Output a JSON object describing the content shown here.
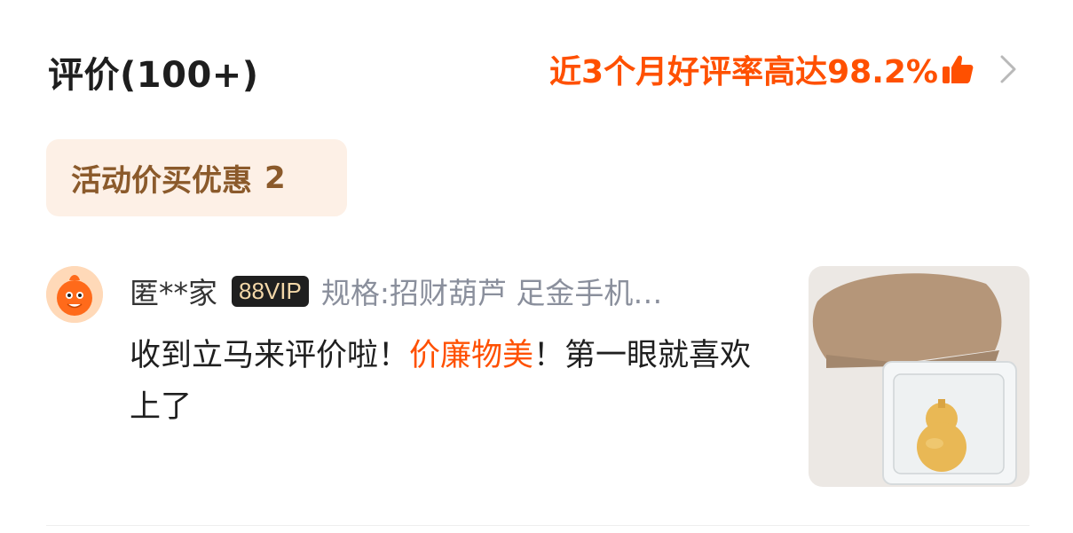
{
  "header": {
    "title": "评价(100+)",
    "rate_text": "近3个月好评率高达98.2%",
    "rate_icon": "thumbs-up-icon",
    "chevron_icon": "chevron-right-icon"
  },
  "tag": {
    "label": "活动价买优惠",
    "count": "2"
  },
  "review": {
    "user": "匿**家",
    "vip_badge": "88VIP",
    "spec": "规格:招财葫芦 足金手机…",
    "text_before": "收到立马来评价啦！",
    "text_highlight": "价廉物美",
    "text_after": "！第一眼就喜欢上了",
    "avatar_icon": "avatar",
    "photo": "review-photo"
  },
  "colors": {
    "accent": "#ff5000",
    "tag_bg": "#fdf0e6",
    "tag_text": "#8b5a2b",
    "spec_gray": "#8a8f9c"
  }
}
